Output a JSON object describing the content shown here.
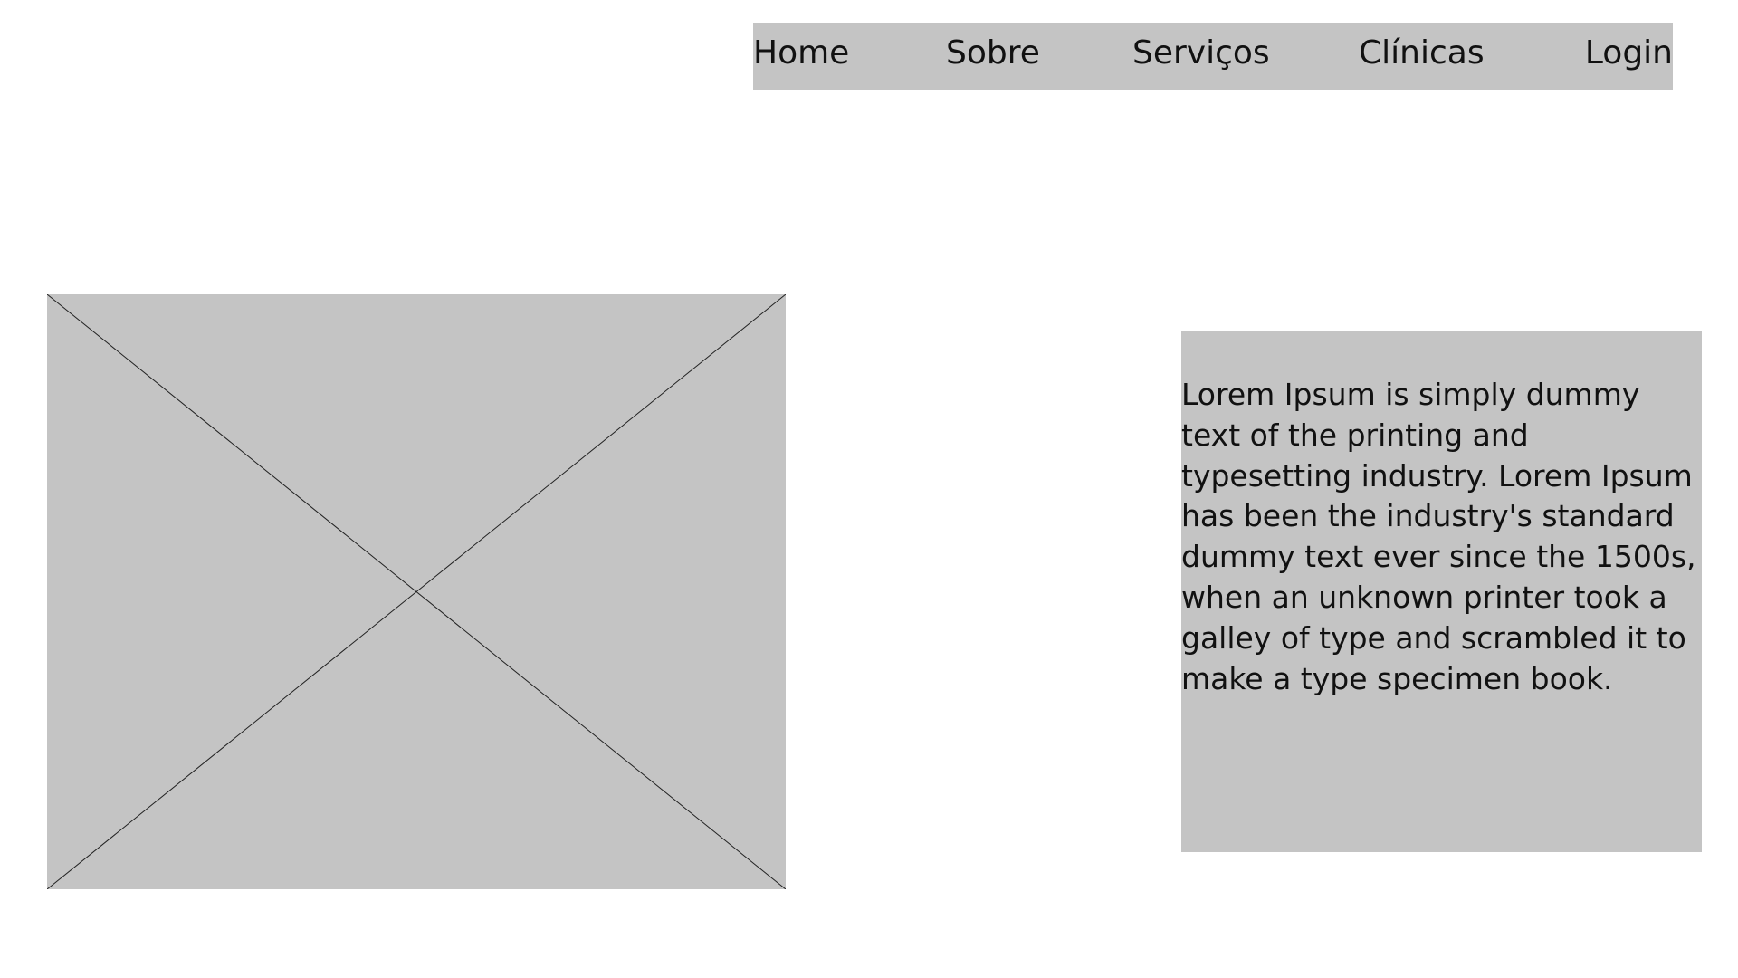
{
  "nav": {
    "items": [
      {
        "label": "Home"
      },
      {
        "label": "Sobre"
      },
      {
        "label": "Serviços"
      },
      {
        "label": "Clínicas"
      },
      {
        "label": "Login"
      }
    ]
  },
  "content": {
    "paragraph": "Lorem Ipsum is simply dummy text of the printing and typesetting industry. Lorem Ipsum has been the industry's standard dummy text ever since the 1500s, when an unknown printer took a galley of type and scrambled it to make a type specimen book."
  },
  "colors": {
    "placeholder_gray": "#c4c4c4",
    "text": "#111111",
    "background": "#ffffff"
  }
}
